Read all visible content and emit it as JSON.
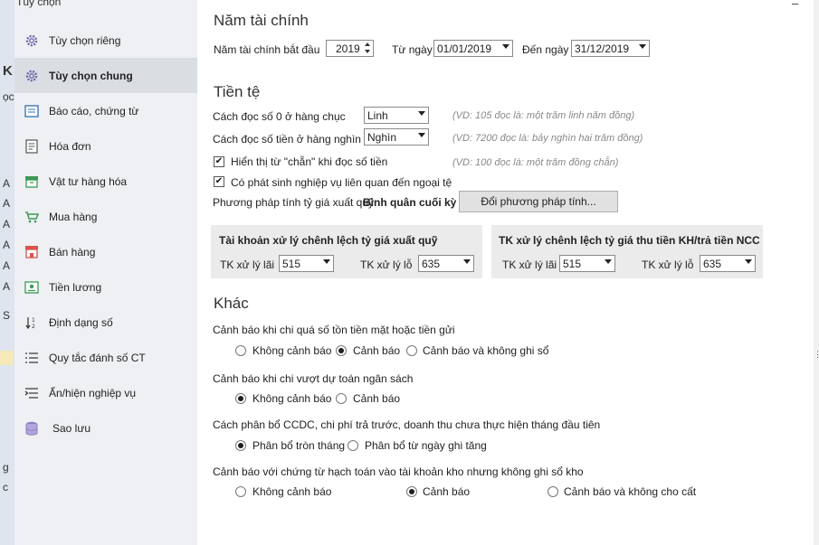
{
  "background_app": {
    "strip_letters": [
      "K",
      "ọc",
      "A",
      "A",
      "A",
      "A",
      "A",
      "A",
      "S",
      "g",
      "c"
    ]
  },
  "dialog": {
    "title": "Tùy chọn",
    "close_glyph": "–"
  },
  "sidebar": {
    "items": [
      {
        "label": "Tùy chọn riêng",
        "icon": "gear-icon"
      },
      {
        "label": "Tùy chọn chung",
        "icon": "gear-icon"
      },
      {
        "label": "Báo cáo, chứng từ",
        "icon": "report-icon"
      },
      {
        "label": "Hóa đơn",
        "icon": "invoice-icon"
      },
      {
        "label": "Vật tư hàng hóa",
        "icon": "box-icon"
      },
      {
        "label": "Mua hàng",
        "icon": "cart-icon"
      },
      {
        "label": "Bán hàng",
        "icon": "store-icon"
      },
      {
        "label": "Tiền lương",
        "icon": "money-icon"
      },
      {
        "label": "Định dạng số",
        "icon": "sort-number-icon"
      },
      {
        "label": "Quy tắc đánh số CT",
        "icon": "numbered-list-icon"
      },
      {
        "label": "Ẩn/hiện nghiệp vụ",
        "icon": "hide-show-icon"
      },
      {
        "label": "Sao lưu",
        "icon": "database-icon"
      }
    ],
    "active_index": 1
  },
  "fiscal": {
    "title": "Năm tài chính",
    "start_label": "Năm tài chính bắt đầu",
    "year": "2019",
    "from_label": "Từ ngày",
    "from_value": "01/01/2019",
    "to_label": "Đến ngày",
    "to_value": "31/12/2019"
  },
  "currency": {
    "title": "Tiền tệ",
    "zero_label": "Cách đọc số 0 ở hàng chục",
    "zero_value": "Linh",
    "zero_hint": "(VD: 105 đọc là: một trăm linh năm đồng)",
    "thousand_label": "Cách đọc số tiền ở hàng nghìn",
    "thousand_value": "Nghìn",
    "thousand_hint": "(VD: 7200 đọc là: bảy nghìn hai trăm đồng)",
    "even_label": "Hiển thị từ \"chẵn\" khi đọc số tiền",
    "even_hint": "(VD: 100 đọc là: một trăm đồng chẵn)",
    "foreign_label": "Có phát sinh nghiệp vụ liên quan đến ngoại tệ",
    "method_label": "Phương pháp tính tỷ giá xuất quỹ:",
    "method_value": "Bình quân cuối kỳ",
    "change_button": "Đổi phương pháp tính..."
  },
  "panels": {
    "left": {
      "title": "Tài khoản xử lý chênh lệch tỷ giá xuất quỹ",
      "gain_label": "TK xử lý lãi",
      "gain_value": "515",
      "loss_label": "TK xử lý lỗ",
      "loss_value": "635"
    },
    "right": {
      "title": "TK xử lý chênh lệch tỷ giá thu tiền KH/trả tiền NCC",
      "gain_label": "TK xử lý lãi",
      "gain_value": "515",
      "loss_label": "TK xử lý lỗ",
      "loss_value": "635"
    }
  },
  "other": {
    "title": "Khác",
    "q1": {
      "label": "Cảnh báo khi chi quá số tồn tiền mặt hoặc tiền gửi",
      "options": [
        "Không cảnh báo",
        "Cảnh báo",
        "Cảnh báo và không ghi sổ"
      ],
      "selected": 1
    },
    "q2": {
      "label": "Cảnh báo khi chi vượt dự toán ngân sách",
      "options": [
        "Không cảnh báo",
        "Cảnh báo"
      ],
      "selected": 0
    },
    "q3": {
      "label": "Cách phân bổ CCDC, chi phí trả trước, doanh thu chưa thực hiện tháng đầu tiên",
      "options": [
        "Phân bổ tròn tháng",
        "Phân bổ từ ngày ghi tăng"
      ],
      "selected": 0
    },
    "q4": {
      "label": "Cảnh báo với chứng từ hạch toán vào tài khoản kho nhưng không ghi sổ kho",
      "options": [
        "Không cảnh báo",
        "Cảnh báo",
        "Cảnh báo và không cho cất"
      ],
      "selected": 1
    }
  }
}
